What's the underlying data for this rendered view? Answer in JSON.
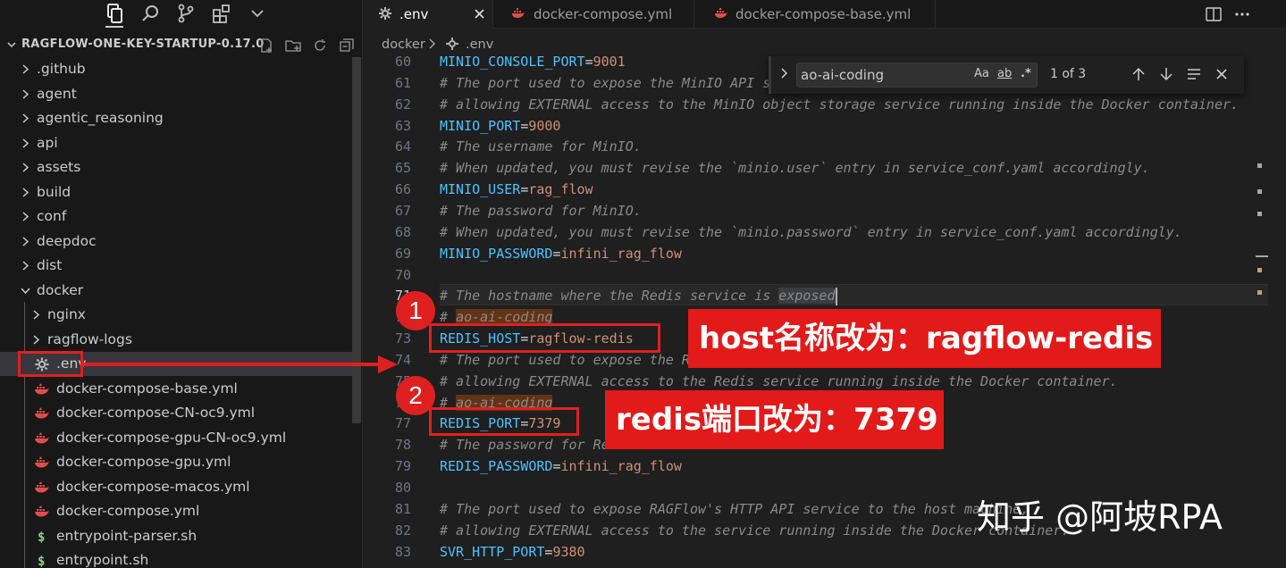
{
  "activity_bar": {
    "icons": [
      "explorer-icon",
      "search-icon",
      "source-control-icon",
      "extensions-icon",
      "chevron-down-icon"
    ]
  },
  "explorer": {
    "title": "RAGFLOW-ONE-KEY-STARTUP-0.17.0",
    "items": [
      {
        "label": ".github",
        "type": "folder",
        "expanded": false
      },
      {
        "label": "agent",
        "type": "folder",
        "expanded": false
      },
      {
        "label": "agentic_reasoning",
        "type": "folder",
        "expanded": false
      },
      {
        "label": "api",
        "type": "folder",
        "expanded": false
      },
      {
        "label": "assets",
        "type": "folder",
        "expanded": false
      },
      {
        "label": "build",
        "type": "folder",
        "expanded": false
      },
      {
        "label": "conf",
        "type": "folder",
        "expanded": false
      },
      {
        "label": "deepdoc",
        "type": "folder",
        "expanded": false
      },
      {
        "label": "dist",
        "type": "folder",
        "expanded": false
      },
      {
        "label": "docker",
        "type": "folder",
        "expanded": true
      },
      {
        "label": "nginx",
        "type": "folder",
        "expanded": false
      },
      {
        "label": "ragflow-logs",
        "type": "folder",
        "expanded": false
      },
      {
        "label": ".env",
        "type": "gear",
        "selected": true
      },
      {
        "label": "docker-compose-base.yml",
        "type": "docker"
      },
      {
        "label": "docker-compose-CN-oc9.yml",
        "type": "docker"
      },
      {
        "label": "docker-compose-gpu-CN-oc9.yml",
        "type": "docker"
      },
      {
        "label": "docker-compose-gpu.yml",
        "type": "docker"
      },
      {
        "label": "docker-compose-macos.yml",
        "type": "docker"
      },
      {
        "label": "docker-compose.yml",
        "type": "docker"
      },
      {
        "label": "entrypoint-parser.sh",
        "type": "shell"
      },
      {
        "label": "entrypoint.sh",
        "type": "shell"
      }
    ]
  },
  "tabs": [
    {
      "label": ".env",
      "active": true
    },
    {
      "label": "docker-compose.yml",
      "active": false
    },
    {
      "label": "docker-compose-base.yml",
      "active": false
    }
  ],
  "breadcrumb": [
    "docker",
    ".env"
  ],
  "find": {
    "query": "ao-ai-coding",
    "match_case": "Aa",
    "whole_word": "ab",
    "regex": ".*",
    "count": "1 of 3"
  },
  "editor": {
    "current_line": 71,
    "lines": [
      {
        "n": "60",
        "k": "MINIO_CONSOLE_PORT",
        "v": "9001"
      },
      {
        "n": "61",
        "c": "# The port used to expose the MinIO API service to the host machine,"
      },
      {
        "n": "62",
        "c": "# allowing EXTERNAL access to the MinIO object storage service running inside the Docker container."
      },
      {
        "n": "63",
        "k": "MINIO_PORT",
        "v": "9000"
      },
      {
        "n": "64",
        "c": "# The username for MinIO."
      },
      {
        "n": "65",
        "c": "# When updated, you must revise the `minio.user` entry in service_conf.yaml accordingly."
      },
      {
        "n": "66",
        "k": "MINIO_USER",
        "v": "rag_flow"
      },
      {
        "n": "67",
        "c": "# The password for MinIO."
      },
      {
        "n": "68",
        "c": "# When updated, you must revise the `minio.password` entry in service_conf.yaml accordingly."
      },
      {
        "n": "69",
        "k": "MINIO_PASSWORD",
        "v": "infini_rag_flow"
      },
      {
        "n": "70",
        "c": ""
      },
      {
        "n": "71",
        "c": "# The hostname where the Redis service is ",
        "sel": "exposed"
      },
      {
        "n": "72",
        "c": "# ",
        "match": "ao-ai-coding"
      },
      {
        "n": "73",
        "k": "REDIS_HOST",
        "v": "ragflow-redis"
      },
      {
        "n": "74",
        "c": "# The port used to expose the Redis service to the host machine,"
      },
      {
        "n": "75",
        "c": "# allowing EXTERNAL access to the Redis service running inside the Docker container."
      },
      {
        "n": "76",
        "c": "# ",
        "match": "ao-ai-coding"
      },
      {
        "n": "77",
        "k": "REDIS_PORT",
        "v": "7379"
      },
      {
        "n": "78",
        "c": "# The password for Redis."
      },
      {
        "n": "79",
        "k": "REDIS_PASSWORD",
        "v": "infini_rag_flow"
      },
      {
        "n": "80",
        "c": ""
      },
      {
        "n": "81",
        "c": "# The port used to expose RAGFlow's HTTP API service to the host machine,"
      },
      {
        "n": "82",
        "c": "# allowing EXTERNAL access to the service running inside the Docker container."
      },
      {
        "n": "83",
        "k": "SVR_HTTP_PORT",
        "v": "9380"
      }
    ]
  },
  "annotations": {
    "badge1": "1",
    "badge2": "2",
    "banner1": "host名称改为：ragflow-redis",
    "banner2": "redis端口改为：7379",
    "accent_color": "#e21a1a"
  },
  "watermark": "知乎 @阿坡RPA"
}
